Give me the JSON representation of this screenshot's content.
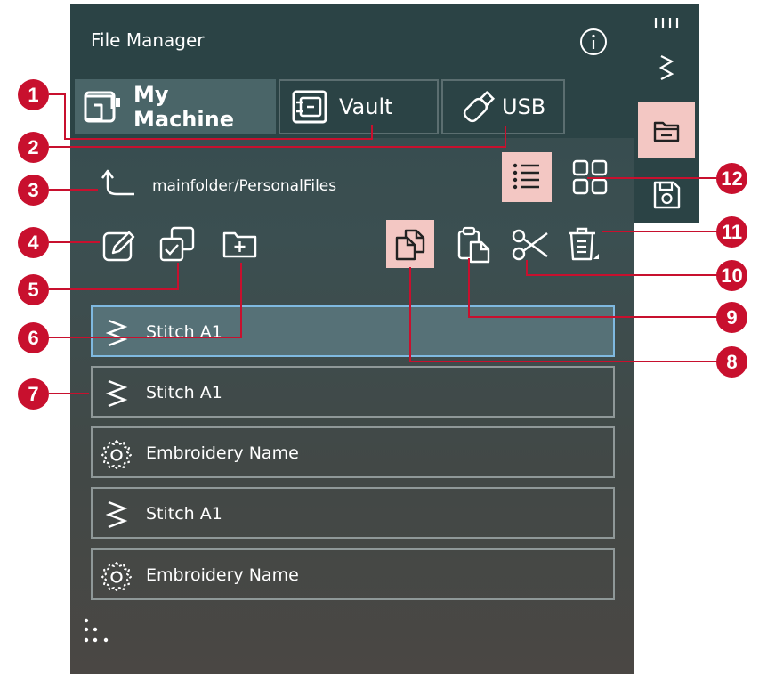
{
  "window": {
    "title": "File Manager"
  },
  "tabs": [
    {
      "label": "My Machine",
      "icon": "sewing-machine-icon",
      "active": true
    },
    {
      "label": "Vault",
      "icon": "vault-icon",
      "active": false
    },
    {
      "label": "USB",
      "icon": "usb-drive-icon",
      "active": false
    }
  ],
  "path": {
    "text": "mainfolder/PersonalFiles"
  },
  "view": {
    "selected": "list"
  },
  "files": [
    {
      "label": "Stitch A1",
      "icon": "stitch-icon",
      "selected": true
    },
    {
      "label": "Stitch A1",
      "icon": "stitch-icon",
      "selected": false
    },
    {
      "label": "Embroidery Name",
      "icon": "embroidery-icon",
      "selected": false
    },
    {
      "label": "Stitch A1",
      "icon": "stitch-icon",
      "selected": false
    },
    {
      "label": "Embroidery Name",
      "icon": "embroidery-icon",
      "selected": false
    }
  ],
  "callouts": [
    "1",
    "2",
    "3",
    "4",
    "5",
    "6",
    "7",
    "8",
    "9",
    "10",
    "11",
    "12"
  ],
  "colors": {
    "accent": "#c8102e",
    "selection": "#f3c7c3",
    "panel": "#2b4345",
    "selected_row_border": "#7fb9e0"
  }
}
